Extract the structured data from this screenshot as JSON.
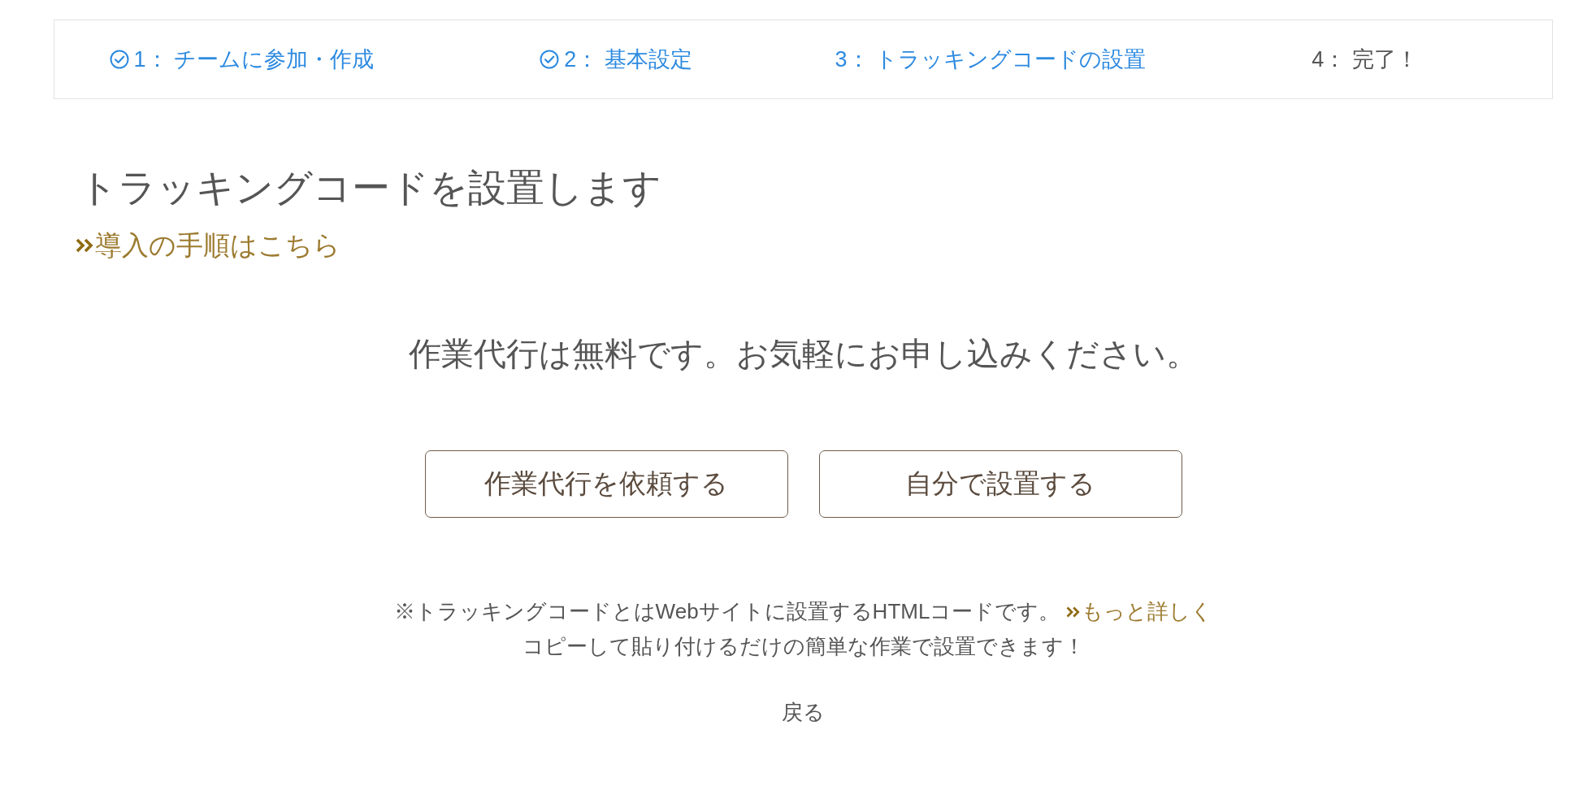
{
  "steps": [
    {
      "label": "1： チームに参加・作成",
      "done": true,
      "reached": true
    },
    {
      "label": "2： 基本設定",
      "done": true,
      "reached": true
    },
    {
      "label": "3： トラッキングコードの設置",
      "done": false,
      "reached": true
    },
    {
      "label": "4： 完了！",
      "done": false,
      "reached": false
    }
  ],
  "heading": "トラッキングコードを設置します",
  "guide_link": "導入の手順はこちら",
  "message": "作業代行は無料です。お気軽にお申し込みください。",
  "buttons": [
    "作業代行を依頼する",
    "自分で設置する"
  ],
  "note": {
    "text": "※トラッキングコードとはWebサイトに設置するHTMLコードです。",
    "link": "もっと詳しく",
    "line_2": "コピーして貼り付けるだけの簡単な作業で設置できます！"
  },
  "back_link": "戻る"
}
